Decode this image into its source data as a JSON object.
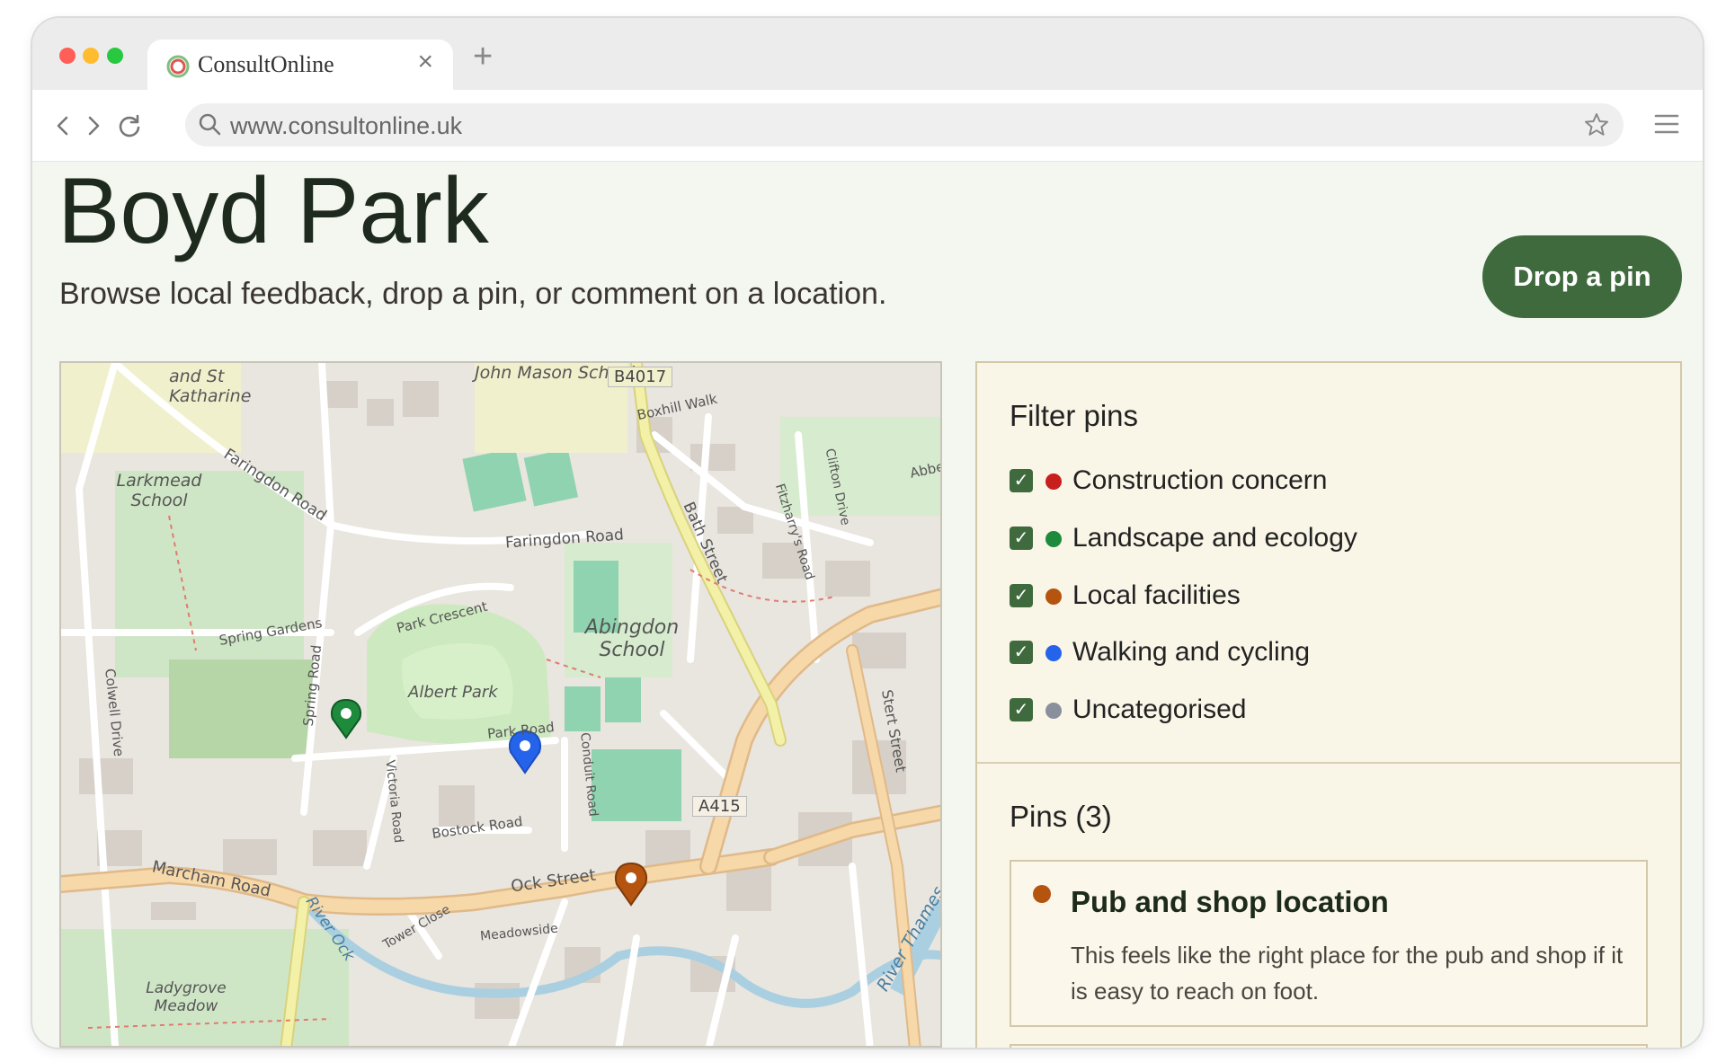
{
  "browser": {
    "tab_title": "ConsultOnline",
    "url": "www.consultonline.uk",
    "new_tab_symbol": "+",
    "close_symbol": "×",
    "icons": [
      "back-icon",
      "forward-icon",
      "reload-icon",
      "search-icon",
      "star-icon",
      "menu-icon"
    ]
  },
  "header": {
    "title": "Boyd Park",
    "subtitle": "Browse local feedback, drop a pin, or comment on a location.",
    "drop_pin_label": "Drop a pin"
  },
  "map": {
    "labels": {
      "school_top": "John Mason School",
      "b4017": "B4017",
      "boxhill": "Boxhill Walk",
      "katharine": "and St Katharine",
      "larkmead": "Larkmead School",
      "faringdon_diag": "Faringdon Road",
      "faringdon": "Faringdon Road",
      "bath_street": "Bath Street",
      "park_crescent": "Park Crescent",
      "abingdon_school": "Abingdon School",
      "spring_gardens": "Spring Gardens",
      "albert_park": "Albert Park",
      "spring_road": "Spring Road",
      "park_road": "Park Road",
      "colwell_drive": "Colwell Drive",
      "a415": "A415",
      "stert_street": "Stert Street",
      "bostock": "Bostock Road",
      "victoria": "Victoria Road",
      "conduit": "Conduit Road",
      "marcham": "Marcham Road",
      "ock_street": "Ock Street",
      "river_ock": "River Ock",
      "tower_close": "Tower Close",
      "meadowside": "Meadowside",
      "ladygrove": "Ladygrove Meadow",
      "river_thames": "River Thames",
      "clifton_drive": "Clifton Drive",
      "fitzharry": "Fitzharry's Road",
      "abbey": "Abbe"
    },
    "markers": [
      {
        "name": "green-pin",
        "color": "#1e8a3c"
      },
      {
        "name": "blue-pin",
        "color": "#2563eb"
      },
      {
        "name": "orange-pin",
        "color": "#b5540f"
      }
    ]
  },
  "filters": {
    "title": "Filter pins",
    "items": [
      {
        "label": "Construction concern",
        "color": "#c81e1e",
        "checked": true
      },
      {
        "label": "Landscape and ecology",
        "color": "#1e8a3c",
        "checked": true
      },
      {
        "label": "Local facilities",
        "color": "#b5540f",
        "checked": true
      },
      {
        "label": "Walking and cycling",
        "color": "#2563eb",
        "checked": true
      },
      {
        "label": "Uncategorised",
        "color": "#8a8f9c",
        "checked": true
      }
    ],
    "check_symbol": "✓"
  },
  "pins": {
    "title": "Pins (3)",
    "items": [
      {
        "title": "Pub and shop location",
        "text": "This feels like the right place for the pub and shop if it is easy to reach on foot.",
        "color": "#b5540f"
      }
    ]
  },
  "colors": {
    "accent": "#3f6a3d",
    "page_bg": "#f4f7ef",
    "panel_bg": "#f9f5e7"
  }
}
